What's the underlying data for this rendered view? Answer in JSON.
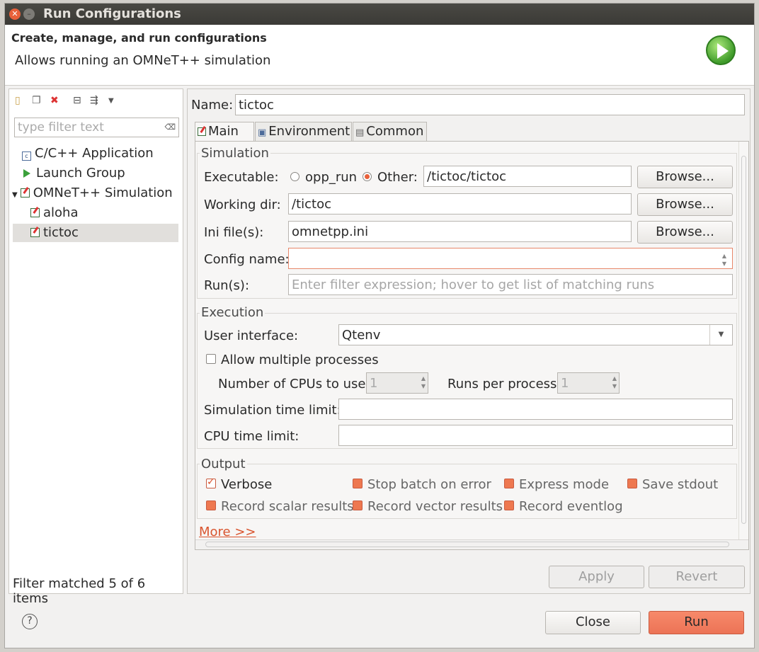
{
  "window": {
    "title": "Run Configurations"
  },
  "header": {
    "title": "Create, manage, and run configurations",
    "description": "Allows running an OMNeT++ simulation"
  },
  "left": {
    "filter_placeholder": "type filter text",
    "tree": [
      {
        "label": "C/C++ Application",
        "icon": "cpp-app-icon"
      },
      {
        "label": "Launch Group",
        "icon": "launch-group-icon"
      },
      {
        "label": "OMNeT++ Simulation",
        "icon": "omnet-sim-icon",
        "expanded": true
      },
      {
        "label": "aloha",
        "icon": "omnet-config-icon"
      },
      {
        "label": "tictoc",
        "icon": "omnet-config-icon",
        "selected": true
      }
    ],
    "status": "Filter matched 5 of 6 items"
  },
  "right": {
    "name_label": "Name:",
    "name_value": "tictoc",
    "tabs": [
      {
        "label": "Main",
        "active": true
      },
      {
        "label": "Environment"
      },
      {
        "label": "Common"
      }
    ],
    "simulation": {
      "title": "Simulation",
      "executable_label": "Executable:",
      "opt_opp_run": "opp_run",
      "opt_other": "Other:",
      "executable_value": "/tictoc/tictoc",
      "workdir_label": "Working dir:",
      "workdir_value": "/tictoc",
      "ini_label": "Ini file(s):",
      "ini_value": "omnetpp.ini",
      "config_label": "Config name:",
      "config_value": "",
      "runs_label": "Run(s):",
      "runs_placeholder": "Enter filter expression; hover to get list of matching runs",
      "browse": "Browse..."
    },
    "execution": {
      "title": "Execution",
      "ui_label": "User interface:",
      "ui_value": "Qtenv",
      "multi_label": "Allow multiple processes",
      "cpus_label": "Number of CPUs to use:",
      "cpus_value": "1",
      "rpp_label": "Runs per process:",
      "rpp_value": "1",
      "simtime_label": "Simulation time limit:",
      "cputime_label": "CPU time limit:"
    },
    "output": {
      "title": "Output",
      "verbose": "Verbose",
      "stop_batch": "Stop batch on error",
      "express": "Express mode",
      "save_stdout": "Save stdout",
      "record_scalar": "Record scalar results",
      "record_vector": "Record vector results",
      "record_eventlog": "Record eventlog"
    },
    "more_link": "More >>",
    "apply": "Apply",
    "revert": "Revert"
  },
  "footer": {
    "close": "Close",
    "run": "Run"
  },
  "colors": {
    "accent": "#e8603a",
    "title_bg": "#3b3a36"
  }
}
